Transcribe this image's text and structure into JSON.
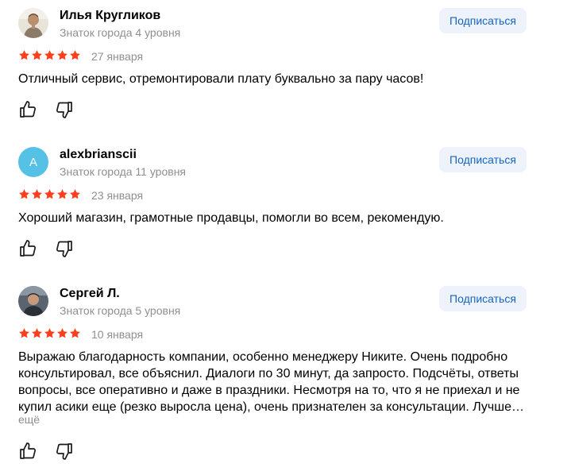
{
  "reviews": [
    {
      "author": "Илья Кругликов",
      "level": "Знаток города 4 уровня",
      "subscribe_label": "Подписаться",
      "rating": 5,
      "date": "27 января",
      "text": "Отличный сервис, отремонтировали плату буквально за пару часов!",
      "avatar_icon": "user-photo"
    },
    {
      "author": "alexbrianscii",
      "level": "Знаток города 11 уровня",
      "subscribe_label": "Подписаться",
      "rating": 5,
      "date": "23 января",
      "text": "Хороший магазин, грамотные продавцы, помогли во всем, рекомендую.",
      "avatar_letter": "A",
      "avatar_color": "#55c1e6"
    },
    {
      "author": "Сергей Л.",
      "level": "Знаток города 5 уровня",
      "subscribe_label": "Подписаться",
      "rating": 5,
      "date": "10 января",
      "text": "Выражаю благодарность компании, особенно менеджеру Никите. Очень подробно консультировал, все объяснил. Диалоги по 30 минут, да запросто. Подсчёты, ответы вопросы, все оперативно и даже в праздники. Несмотря на то, что я не приехал и не купил асики еще (резко выросла цена), очень признателен за консультации. Лучше…",
      "more_label": "ещё",
      "avatar_icon": "user-photo"
    }
  ],
  "colors": {
    "star": "#fc3f1d",
    "accent": "#1565c0",
    "subscribe_bg": "#eef3fb",
    "muted": "#8f8f8f"
  }
}
